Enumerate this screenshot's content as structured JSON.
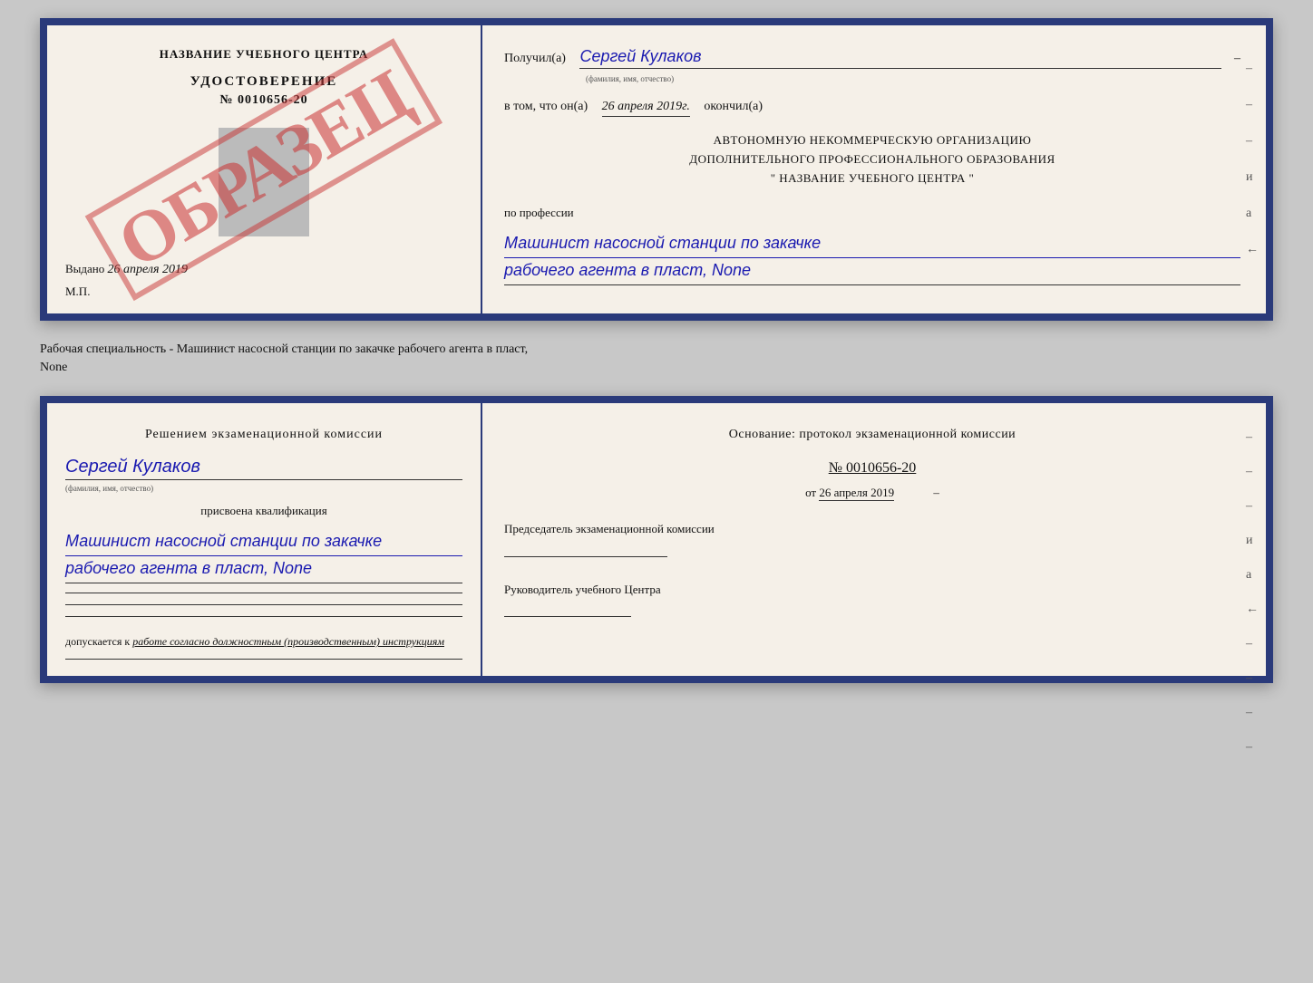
{
  "top_left": {
    "title": "НАЗВАНИЕ УЧЕБНОГО ЦЕНТРА",
    "cert_label": "УДОСТОВЕРЕНИЕ",
    "cert_number": "№ 0010656-20",
    "issued_prefix": "Выдано",
    "issued_date": "26 апреля 2019",
    "mp_label": "М.П.",
    "watermark": "ОБРАЗЕЦ"
  },
  "top_right": {
    "recipient_prefix": "Получил(а)",
    "recipient_name": "Сергей Кулаков",
    "fio_hint": "(фамилия, имя, отчество)",
    "date_prefix": "в том, что он(а)",
    "date_value": "26 апреля 2019г.",
    "finished_label": "окончил(а)",
    "org_line1": "АВТОНОМНУЮ НЕКОММЕРЧЕСКУЮ ОРГАНИЗАЦИЮ",
    "org_line2": "ДОПОЛНИТЕЛЬНОГО ПРОФЕССИОНАЛЬНОГО ОБРАЗОВАНИЯ",
    "org_line3": "\"  НАЗВАНИЕ УЧЕБНОГО ЦЕНТРА  \"",
    "profession_label": "по профессии",
    "profession_line1": "Машинист насосной станции по закачке",
    "profession_line2": "рабочего агента в пласт, None",
    "dashes": [
      "-",
      "-",
      "-",
      "и",
      "а",
      "←"
    ]
  },
  "middle": {
    "text": "Рабочая специальность - Машинист насосной станции по закачке рабочего агента в пласт,",
    "text2": "None"
  },
  "bottom_left": {
    "commission_title": "Решением  экзаменационной  комиссии",
    "name": "Сергей Кулаков",
    "fio_hint": "(фамилия, имя, отчество)",
    "assigned_text": "присвоена квалификация",
    "qual_line1": "Машинист насосной станции по закачке",
    "qual_line2": "рабочего агента в пласт, None",
    "allowed_prefix": "допускается к",
    "allowed_text": "работе согласно должностным (производственным) инструкциям"
  },
  "bottom_right": {
    "basis_title": "Основание: протокол экзаменационной комиссии",
    "protocol_number": "№  0010656-20",
    "protocol_date_prefix": "от",
    "protocol_date": "26 апреля 2019",
    "chairman_label": "Председатель экзаменационной комиссии",
    "director_label": "Руководитель учебного Центра",
    "dashes": [
      "-",
      "-",
      "-",
      "и",
      "а",
      "←",
      "-",
      "-",
      "-",
      "-"
    ]
  }
}
